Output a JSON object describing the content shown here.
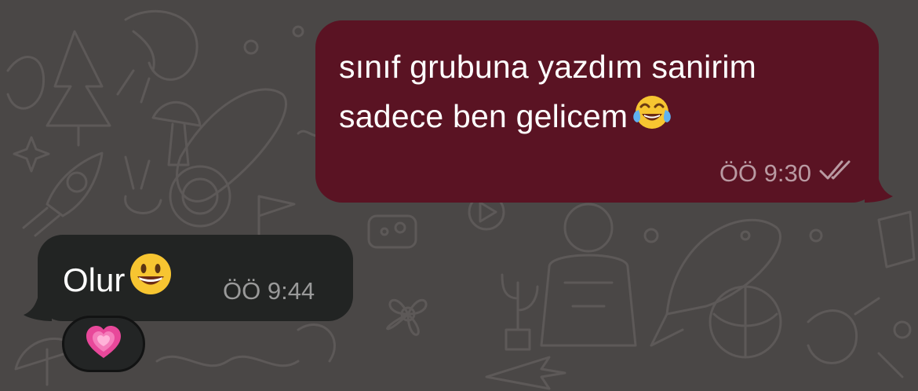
{
  "chat": {
    "background_color": "#4a4746",
    "outgoing": {
      "lines": [
        "sınıf grubuna yazdım sanirim",
        "sadece ben gelicem"
      ],
      "emoji": "face-with-tears-of-joy",
      "time": "ÖÖ 9:30",
      "status": "read-double-check",
      "bubble_color": "#5a1323"
    },
    "incoming": {
      "text": "Olur",
      "emoji": "grinning-face",
      "time": "ÖÖ 9:44",
      "bubble_color": "#222423",
      "reaction": "growing-heart"
    }
  }
}
